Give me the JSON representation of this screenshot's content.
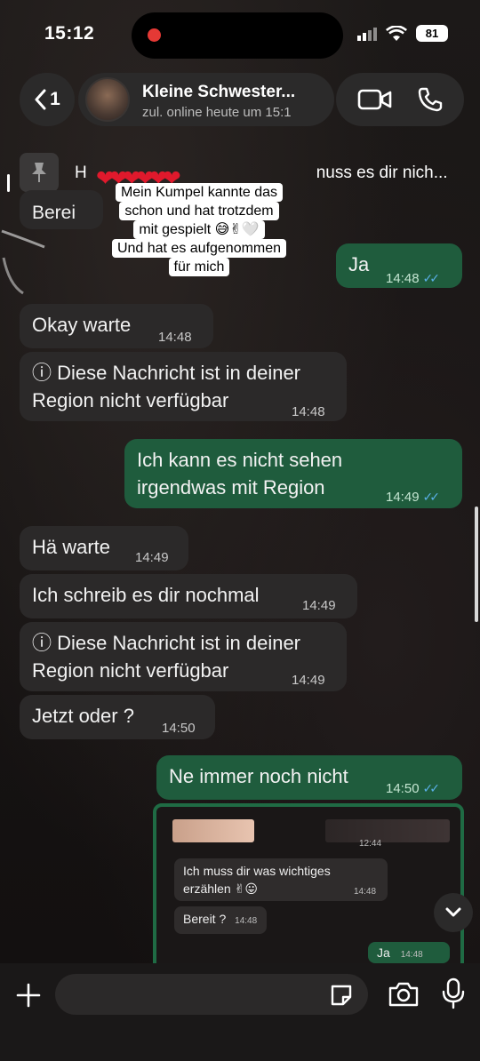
{
  "status_bar": {
    "time": "15:12",
    "battery": "81"
  },
  "header": {
    "back_count": "1",
    "contact_name": "Kleine Schwester...",
    "contact_status": "zul. online heute um 15:1"
  },
  "pinned": {
    "text": "H",
    "text_tail": "nuss es dir nich..."
  },
  "overlay": {
    "hearts": "❤❤❤❤❤❤",
    "lines": [
      "Mein Kumpel kannte das",
      "schon und hat trotzdem",
      "mit  gespielt 😅✌🤍",
      "Und hat es aufgenommen",
      "für mich"
    ],
    "partial_bubble": "Berei"
  },
  "messages": [
    {
      "dir": "out",
      "text": "Ja",
      "time": "14:48"
    },
    {
      "dir": "in",
      "text": "Okay warte",
      "time": "14:48"
    },
    {
      "dir": "in",
      "text": "ⓘ Diese Nachricht ist in deiner Region nicht verfügbar",
      "time": "14:48"
    },
    {
      "dir": "out",
      "text": "Ich kann es nicht sehen irgendwas mit Region",
      "time": "14:49"
    },
    {
      "dir": "in",
      "text": "Hä warte",
      "time": "14:49"
    },
    {
      "dir": "in",
      "text": "Ich schreib es dir nochmal",
      "time": "14:49"
    },
    {
      "dir": "in",
      "text": "ⓘ Diese Nachricht ist in deiner Region nicht verfügbar",
      "time": "14:49"
    },
    {
      "dir": "in",
      "text": "Jetzt oder ?",
      "time": "14:50"
    },
    {
      "dir": "out",
      "text": "Ne immer noch nicht",
      "time": "14:50"
    }
  ],
  "embedded_screenshot": {
    "photo_time": "12:44",
    "msg1": "Ich muss dir was wichtiges erzählen ✌😛",
    "msg1_time": "14:48",
    "msg2": "Bereit ?",
    "msg2_time": "14:48",
    "msg3": "Ja",
    "msg3_time": "14:48"
  },
  "input": {
    "placeholder": ""
  },
  "colors": {
    "outgoing_bubble": "#1f5c3d",
    "incoming_bubble": "#2b2929",
    "read_ticks": "#5ab0e8"
  }
}
